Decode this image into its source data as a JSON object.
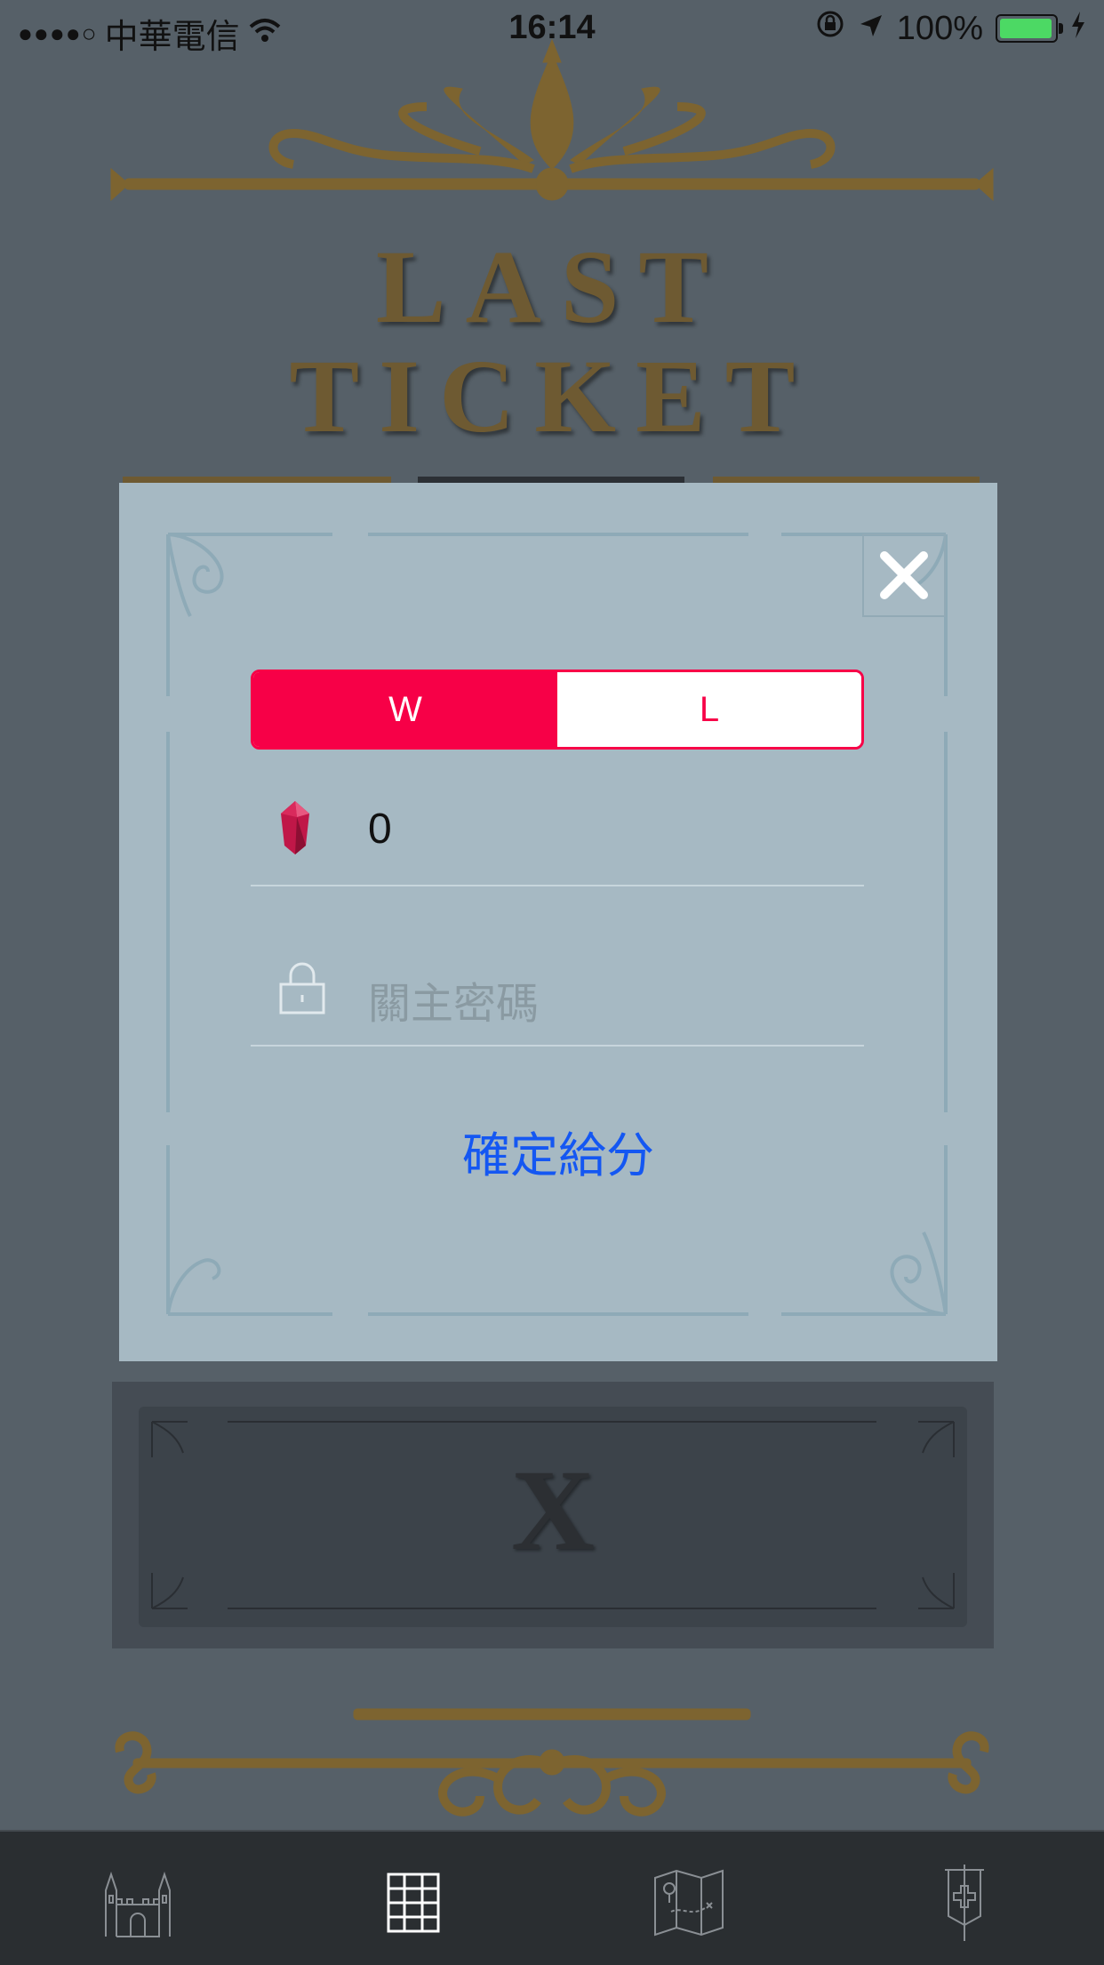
{
  "status_bar": {
    "signal": "●●●●○",
    "carrier": "中華電信",
    "time": "16:14",
    "battery_percent": "100%"
  },
  "background": {
    "logo_line1": "LAST",
    "logo_line2": "TICKET",
    "card_label": "X"
  },
  "modal": {
    "segments": [
      {
        "label": "W",
        "selected": true
      },
      {
        "label": "L",
        "selected": false
      }
    ],
    "points_value": "0",
    "password_placeholder": "關主密碼",
    "confirm_label": "確定給分"
  },
  "tab_bar": {
    "items": [
      {
        "icon": "castle-icon"
      },
      {
        "icon": "grid-icon",
        "selected": true
      },
      {
        "icon": "map-icon"
      },
      {
        "icon": "banner-icon"
      }
    ]
  },
  "colors": {
    "accent": "#f70047",
    "link": "#1457f2",
    "modal_bg": "#a6b9c3",
    "gold": "#7d6430"
  }
}
